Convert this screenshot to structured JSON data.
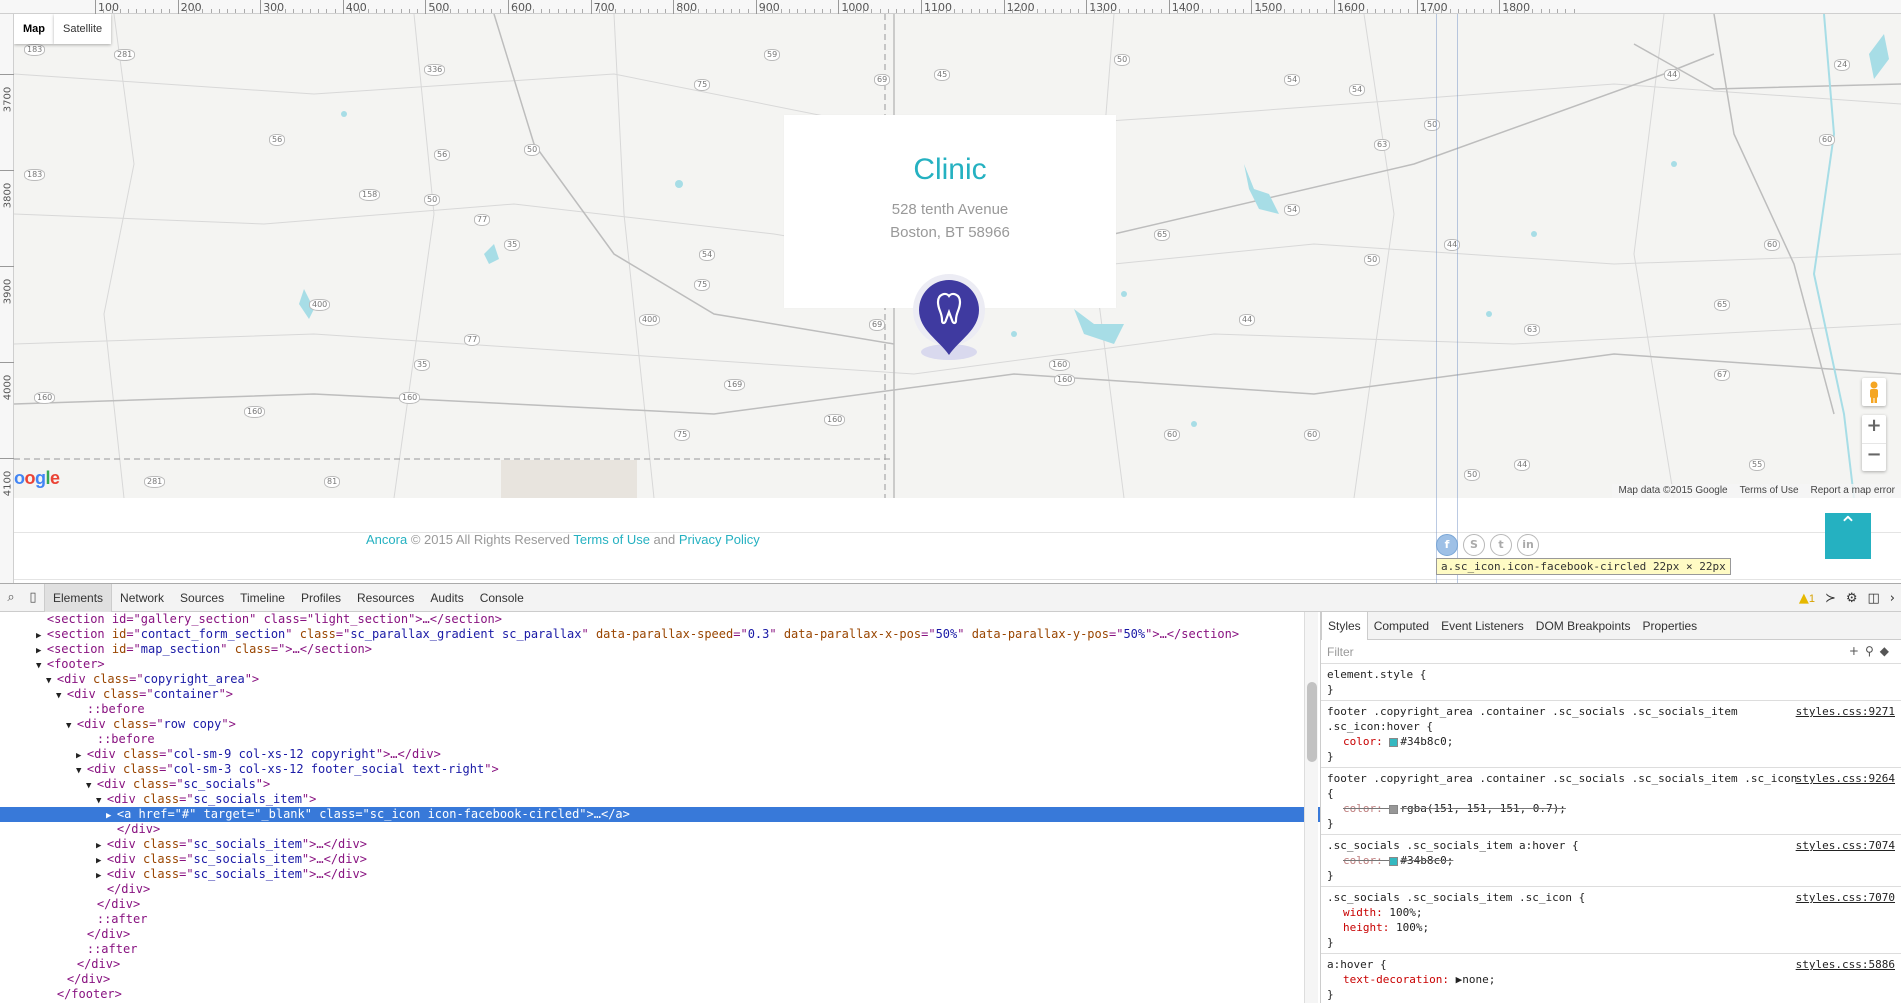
{
  "ruler": {
    "top_labels": [
      "100",
      "200",
      "300",
      "400",
      "500",
      "600",
      "700",
      "800",
      "900",
      "1000",
      "1100",
      "1200",
      "1300",
      "1400",
      "1500",
      "1600",
      "1700",
      "1800"
    ],
    "left_labels": [
      "3700",
      "3800",
      "3900",
      "4000",
      "4100"
    ]
  },
  "map": {
    "type_buttons": {
      "map": "Map",
      "satellite": "Satellite"
    },
    "shields": [
      "183",
      "281",
      "336",
      "75",
      "59",
      "69",
      "45",
      "50",
      "54",
      "56",
      "50",
      "56",
      "183",
      "158",
      "50",
      "77",
      "35",
      "54",
      "400",
      "75",
      "400",
      "77",
      "35",
      "160",
      "160",
      "160",
      "169",
      "75",
      "160",
      "69",
      "160",
      "65",
      "54",
      "44",
      "50",
      "63",
      "50",
      "54",
      "44",
      "63",
      "65",
      "60",
      "60",
      "44",
      "281",
      "81",
      "60",
      "60",
      "160",
      "67",
      "55",
      "50",
      "44",
      "24"
    ],
    "card": {
      "title": "Clinic",
      "line1": "528 tenth Avenue",
      "line2": "Boston, BT 58966"
    },
    "zoom_in": "+",
    "zoom_out": "−",
    "logo": "oogle",
    "footer": {
      "data": "Map data ©2015 Google",
      "terms": "Terms of Use",
      "report": "Report a map error"
    }
  },
  "footer": {
    "brand": "Ancora",
    "copy_text": " © 2015 All Rights Reserved ",
    "terms": "Terms of Use",
    "and": " and ",
    "privacy": "Privacy Policy",
    "socials": [
      {
        "name": "facebook",
        "glyph": "f"
      },
      {
        "name": "skype",
        "glyph": "S"
      },
      {
        "name": "twitter",
        "glyph": "t"
      },
      {
        "name": "linkedin",
        "glyph": "in"
      }
    ],
    "tooltip": {
      "selector": "a.sc_icon.icon-facebook-circled",
      "size": "22px × 22px"
    },
    "to_top": "⌃"
  },
  "devtools": {
    "tabs": [
      "Elements",
      "Network",
      "Sources",
      "Timeline",
      "Profiles",
      "Resources",
      "Audits",
      "Console"
    ],
    "active_tab": "Elements",
    "warning_count": "1",
    "dom_lines": [
      {
        "indent": 3,
        "arrow": "",
        "html": [
          [
            "tg",
            "<section id=\"gallery_section\" class=\"light_section\">…</section>"
          ]
        ]
      },
      {
        "indent": 3,
        "arrow": "▶",
        "html": [
          [
            "tg",
            "<section "
          ],
          [
            "an",
            "id"
          ],
          [
            "tg",
            "=\""
          ],
          [
            "av",
            "contact_form_section"
          ],
          [
            "tg",
            "\" "
          ],
          [
            "an",
            "class"
          ],
          [
            "tg",
            "=\""
          ],
          [
            "av",
            "sc_parallax_gradient sc_parallax"
          ],
          [
            "tg",
            "\" "
          ],
          [
            "an",
            "data-parallax-speed"
          ],
          [
            "tg",
            "=\""
          ],
          [
            "av",
            "0.3"
          ],
          [
            "tg",
            "\" "
          ],
          [
            "an",
            "data-parallax-x-pos"
          ],
          [
            "tg",
            "=\""
          ],
          [
            "av",
            "50%"
          ],
          [
            "tg",
            "\" "
          ],
          [
            "an",
            "data-parallax-y-pos"
          ],
          [
            "tg",
            "=\""
          ],
          [
            "av",
            "50%"
          ],
          [
            "tg",
            "\">…</section>"
          ]
        ]
      },
      {
        "indent": 3,
        "arrow": "▶",
        "html": [
          [
            "tg",
            "<section "
          ],
          [
            "an",
            "id"
          ],
          [
            "tg",
            "=\""
          ],
          [
            "av",
            "map_section"
          ],
          [
            "tg",
            "\" "
          ],
          [
            "an",
            "class"
          ],
          [
            "tg",
            "=\">…</section>"
          ]
        ]
      },
      {
        "indent": 3,
        "arrow": "▼",
        "html": [
          [
            "tg",
            "<footer>"
          ]
        ]
      },
      {
        "indent": 4,
        "arrow": "▼",
        "html": [
          [
            "tg",
            "<div "
          ],
          [
            "an",
            "class"
          ],
          [
            "tg",
            "=\""
          ],
          [
            "av",
            "copyright_area"
          ],
          [
            "tg",
            "\">"
          ]
        ]
      },
      {
        "indent": 5,
        "arrow": "▼",
        "html": [
          [
            "tg",
            "<div "
          ],
          [
            "an",
            "class"
          ],
          [
            "tg",
            "=\""
          ],
          [
            "av",
            "container"
          ],
          [
            "tg",
            "\">"
          ]
        ]
      },
      {
        "indent": 7,
        "arrow": "",
        "html": [
          [
            "ps",
            "::before"
          ]
        ]
      },
      {
        "indent": 6,
        "arrow": "▼",
        "html": [
          [
            "tg",
            "<div "
          ],
          [
            "an",
            "class"
          ],
          [
            "tg",
            "=\""
          ],
          [
            "av",
            "row copy"
          ],
          [
            "tg",
            "\">"
          ]
        ]
      },
      {
        "indent": 8,
        "arrow": "",
        "html": [
          [
            "ps",
            "::before"
          ]
        ]
      },
      {
        "indent": 7,
        "arrow": "▶",
        "html": [
          [
            "tg",
            "<div "
          ],
          [
            "an",
            "class"
          ],
          [
            "tg",
            "=\""
          ],
          [
            "av",
            "col-sm-9 col-xs-12 copyright"
          ],
          [
            "tg",
            "\">…</div>"
          ]
        ]
      },
      {
        "indent": 7,
        "arrow": "▼",
        "html": [
          [
            "tg",
            "<div "
          ],
          [
            "an",
            "class"
          ],
          [
            "tg",
            "=\""
          ],
          [
            "av",
            "col-sm-3 col-xs-12 footer_social text-right"
          ],
          [
            "tg",
            "\">"
          ]
        ]
      },
      {
        "indent": 8,
        "arrow": "▼",
        "html": [
          [
            "tg",
            "<div "
          ],
          [
            "an",
            "class"
          ],
          [
            "tg",
            "=\""
          ],
          [
            "av",
            "sc_socials"
          ],
          [
            "tg",
            "\">"
          ]
        ]
      },
      {
        "indent": 9,
        "arrow": "▼",
        "html": [
          [
            "tg",
            "<div "
          ],
          [
            "an",
            "class"
          ],
          [
            "tg",
            "=\""
          ],
          [
            "av",
            "sc_socials_item"
          ],
          [
            "tg",
            "\">"
          ]
        ]
      },
      {
        "indent": 10,
        "arrow": "▶",
        "selected": true,
        "html": [
          [
            "tg",
            "<a "
          ],
          [
            "an",
            "href"
          ],
          [
            "tg",
            "=\""
          ],
          [
            "av",
            "#"
          ],
          [
            "tg",
            "\" "
          ],
          [
            "an",
            "target"
          ],
          [
            "tg",
            "=\""
          ],
          [
            "av",
            "_blank"
          ],
          [
            "tg",
            "\" "
          ],
          [
            "an",
            "class"
          ],
          [
            "tg",
            "=\""
          ],
          [
            "av",
            "sc_icon icon-facebook-circled"
          ],
          [
            "tg",
            "\">…</a>"
          ]
        ]
      },
      {
        "indent": 10,
        "arrow": "",
        "html": [
          [
            "tg",
            "</div>"
          ]
        ]
      },
      {
        "indent": 9,
        "arrow": "▶",
        "html": [
          [
            "tg",
            "<div "
          ],
          [
            "an",
            "class"
          ],
          [
            "tg",
            "=\""
          ],
          [
            "av",
            "sc_socials_item"
          ],
          [
            "tg",
            "\">…</div>"
          ]
        ]
      },
      {
        "indent": 9,
        "arrow": "▶",
        "html": [
          [
            "tg",
            "<div "
          ],
          [
            "an",
            "class"
          ],
          [
            "tg",
            "=\""
          ],
          [
            "av",
            "sc_socials_item"
          ],
          [
            "tg",
            "\">…</div>"
          ]
        ]
      },
      {
        "indent": 9,
        "arrow": "▶",
        "html": [
          [
            "tg",
            "<div "
          ],
          [
            "an",
            "class"
          ],
          [
            "tg",
            "=\""
          ],
          [
            "av",
            "sc_socials_item"
          ],
          [
            "tg",
            "\">…</div>"
          ]
        ]
      },
      {
        "indent": 9,
        "arrow": "",
        "html": [
          [
            "tg",
            "</div>"
          ]
        ]
      },
      {
        "indent": 8,
        "arrow": "",
        "html": [
          [
            "tg",
            "</div>"
          ]
        ]
      },
      {
        "indent": 8,
        "arrow": "",
        "html": [
          [
            "ps",
            "::after"
          ]
        ]
      },
      {
        "indent": 7,
        "arrow": "",
        "html": [
          [
            "tg",
            "</div>"
          ]
        ]
      },
      {
        "indent": 7,
        "arrow": "",
        "html": [
          [
            "ps",
            "::after"
          ]
        ]
      },
      {
        "indent": 6,
        "arrow": "",
        "html": [
          [
            "tg",
            "</div>"
          ]
        ]
      },
      {
        "indent": 5,
        "arrow": "",
        "html": [
          [
            "tg",
            "</div>"
          ]
        ]
      },
      {
        "indent": 4,
        "arrow": "",
        "html": [
          [
            "tg",
            "</footer>"
          ]
        ]
      }
    ],
    "style_tabs": [
      "Styles",
      "Computed",
      "Event Listeners",
      "DOM Breakpoints",
      "Properties"
    ],
    "filter_placeholder": "Filter",
    "rules": [
      {
        "selector": "element.style {",
        "source": "",
        "props": []
      },
      {
        "selector": "footer .copyright_area .container .sc_socials .sc_socials_item .sc_icon:hover {",
        "source": "styles.css:9271",
        "props": [
          {
            "name": "color",
            "value": "#34b8c0;",
            "swatch": "#34b8c0",
            "struck": false
          }
        ]
      },
      {
        "selector": "footer .copyright_area .container .sc_socials .sc_socials_item .sc_icon {",
        "source": "styles.css:9264",
        "props": [
          {
            "name": "color",
            "value": "rgba(151, 151, 151, 0.7);",
            "swatch": "#979797",
            "struck": true
          }
        ]
      },
      {
        "selector": ".sc_socials .sc_socials_item a:hover {",
        "source": "styles.css:7074",
        "props": [
          {
            "name": "color",
            "value": "#34b8c0;",
            "swatch": "#34b8c0",
            "struck": true
          }
        ]
      },
      {
        "selector": ".sc_socials .sc_socials_item .sc_icon {",
        "source": "styles.css:7070",
        "props": [
          {
            "name": "width",
            "value": "100%;",
            "struck": false
          },
          {
            "name": "height",
            "value": "100%;",
            "struck": false
          }
        ]
      },
      {
        "selector": "a:hover {",
        "source": "styles.css:5886",
        "props": [
          {
            "name": "text-decoration",
            "value": "▶none;",
            "struck": false
          }
        ]
      }
    ]
  },
  "colors": {
    "accent": "#25b1c1",
    "pin": "#3f3aa0",
    "selection": "#3879d9"
  }
}
